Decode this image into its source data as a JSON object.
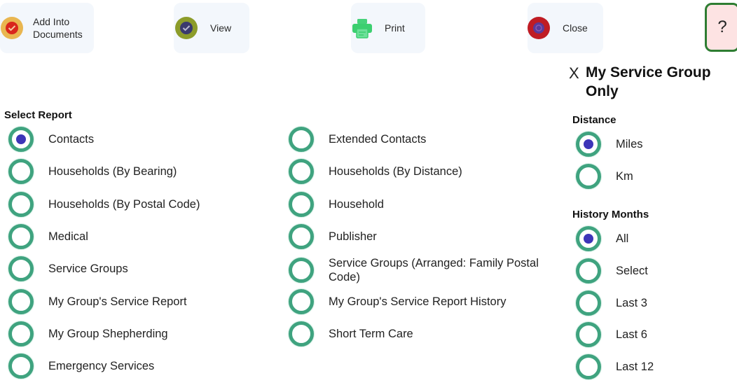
{
  "toolbar": {
    "add_into_documents": {
      "label_line1": "Add Into",
      "label_line2": "Documents",
      "icon": "check-badge-icon"
    },
    "view": {
      "label": "View",
      "icon": "check-badge-icon"
    },
    "print": {
      "label": "Print",
      "icon": "printer-icon"
    },
    "close": {
      "label": "Close",
      "icon": "close-badge-icon"
    },
    "help": {
      "label": "?"
    }
  },
  "filter": {
    "my_service_group_only": {
      "mark": "X",
      "label": "My Service Group Only",
      "checked": true
    }
  },
  "select_report": {
    "title": "Select Report",
    "options_left": [
      {
        "label": "Contacts",
        "selected": true
      },
      {
        "label": "Households (By Bearing)",
        "selected": false
      },
      {
        "label": "Households (By Postal Code)",
        "selected": false
      },
      {
        "label": "Medical",
        "selected": false
      },
      {
        "label": "Service Groups",
        "selected": false
      },
      {
        "label": "My Group's Service Report",
        "selected": false
      },
      {
        "label": "My Group Shepherding",
        "selected": false
      },
      {
        "label": "Emergency Services",
        "selected": false
      }
    ],
    "options_right": [
      {
        "label": "Extended Contacts",
        "selected": false
      },
      {
        "label": "Households (By Distance)",
        "selected": false
      },
      {
        "label": "Household",
        "selected": false
      },
      {
        "label": "Publisher",
        "selected": false
      },
      {
        "label": "Service Groups (Arranged: Family Postal Code)",
        "selected": false
      },
      {
        "label": "My Group's Service Report History",
        "selected": false
      },
      {
        "label": "Short Term Care",
        "selected": false
      }
    ]
  },
  "distance": {
    "title": "Distance",
    "options": [
      {
        "label": "Miles",
        "selected": true
      },
      {
        "label": "Km",
        "selected": false
      }
    ]
  },
  "history_months": {
    "title": "History Months",
    "options": [
      {
        "label": "All",
        "selected": true
      },
      {
        "label": "Select",
        "selected": false
      },
      {
        "label": "Last 3",
        "selected": false
      },
      {
        "label": "Last 6",
        "selected": false
      },
      {
        "label": "Last 12",
        "selected": false
      }
    ]
  },
  "colors": {
    "radio_ring": "#3fa37f",
    "radio_dot": "#3d35b8",
    "toolbar_bg": "#f3f7fc",
    "help_border": "#2e7d32",
    "help_bg": "#fde3e3"
  }
}
